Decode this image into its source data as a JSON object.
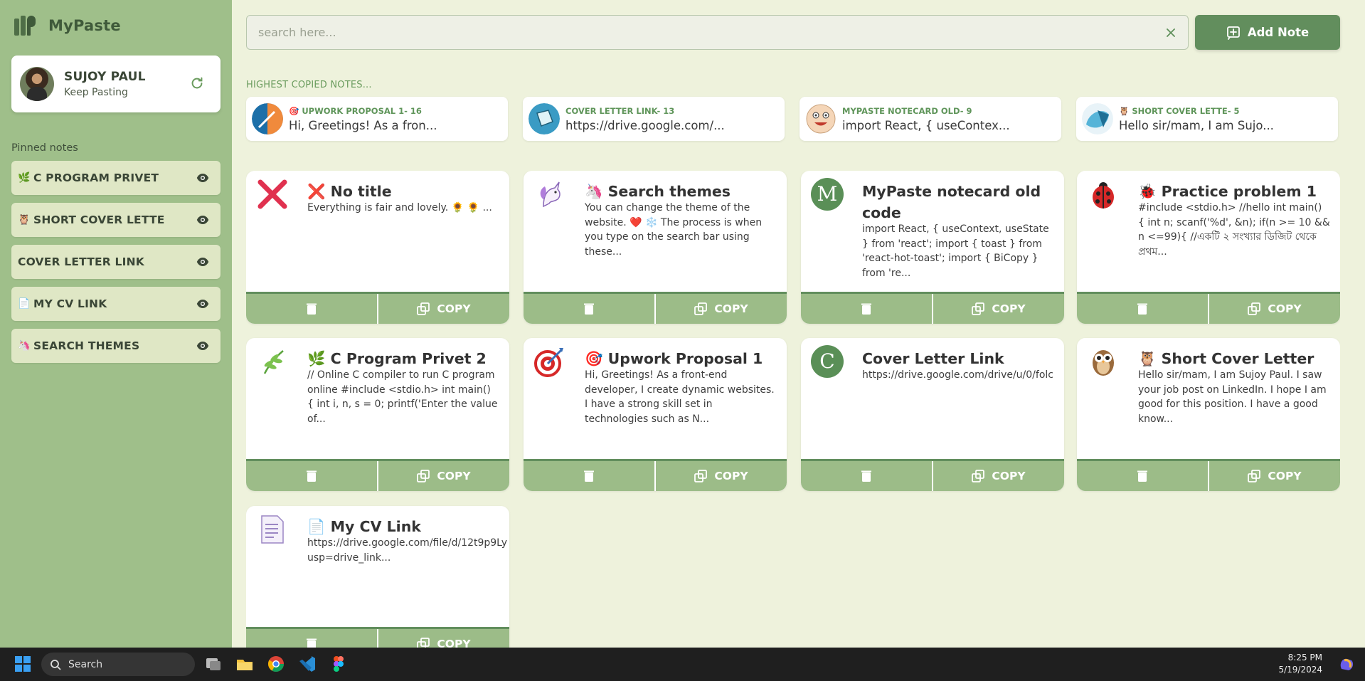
{
  "brand": {
    "name": "MyPaste"
  },
  "profile": {
    "name": "SUJOY PAUL",
    "subtitle": "Keep Pasting"
  },
  "sidebar": {
    "pinned_title": "Pinned notes",
    "items": [
      {
        "emoji": "🌿",
        "label": "C PROGRAM PRIVET"
      },
      {
        "emoji": "🦉",
        "label": "SHORT COVER LETTE"
      },
      {
        "emoji": "",
        "label": "COVER LETTER LINK"
      },
      {
        "emoji": "📄",
        "label": "MY CV LINK"
      },
      {
        "emoji": "🦄",
        "label": "SEARCH THEMES"
      }
    ]
  },
  "search": {
    "placeholder": "search here...",
    "value": ""
  },
  "add_button": {
    "label": "Add Note"
  },
  "highest": {
    "title": "HIGHEST COPIED NOTES...",
    "items": [
      {
        "label": "🎯 UPWORK PROPOSAL 1- 16",
        "preview": "Hi, Greetings! As a fron..."
      },
      {
        "label": "COVER LETTER LINK- 13",
        "preview": "https://drive.google.com/..."
      },
      {
        "label": "MYPASTE NOTECARD OLD- 9",
        "preview": "import React, { useContex..."
      },
      {
        "label": "🦉 SHORT COVER LETTE- 5",
        "preview": "Hello sir/mam, I am Sujo..."
      }
    ]
  },
  "notes": [
    {
      "title": "❌ No title",
      "body": "Everything is fair and lovely. 🌻 🌻 ..."
    },
    {
      "title": "🦄 Search themes",
      "body": "You can change the theme of the website. ❤️ ❄️ The process is when you type on the search bar using these..."
    },
    {
      "title": "MyPaste notecard old code",
      "body": "import React, { useContext, useState } from 'react'; import { toast } from 'react-hot-toast'; import { BiCopy } from 're..."
    },
    {
      "title": "🐞 Practice problem 1",
      "body": "#include <stdio.h> //hello int main() { int n; scanf('%d', &n); if(n >= 10 && n <=99){ //একটি ২ সংখ্যার ডিজিট থেকে প্রথম..."
    },
    {
      "title": "🌿 C Program Privet 2",
      "body": "// Online C compiler to run C program online #include <stdio.h> int main() { int i, n, s = 0; printf('Enter the value of..."
    },
    {
      "title": "🎯 Upwork Proposal 1",
      "body": "Hi, Greetings! As a front-end developer, I create dynamic websites. I have a strong skill set in technologies such as N..."
    },
    {
      "title": "Cover Letter Link",
      "body": "https://drive.google.com/drive/u/0/folc"
    },
    {
      "title": "🦉 Short Cover Letter",
      "body": "Hello sir/mam, I am Sujoy Paul. I saw your job post on LinkedIn. I hope I am good for this position. I have a good know..."
    },
    {
      "title": "📄 My CV Link",
      "body": "https://drive.google.com/file/d/12t9p9Ly usp=drive_link..."
    }
  ],
  "copy_label": "COPY",
  "taskbar": {
    "search_label": "Search",
    "time": "8:25 PM",
    "date": "5/19/2024"
  },
  "colors": {
    "accent": "#628e5d",
    "sidebar": "#9fbf8a",
    "background": "#eef2dc"
  }
}
